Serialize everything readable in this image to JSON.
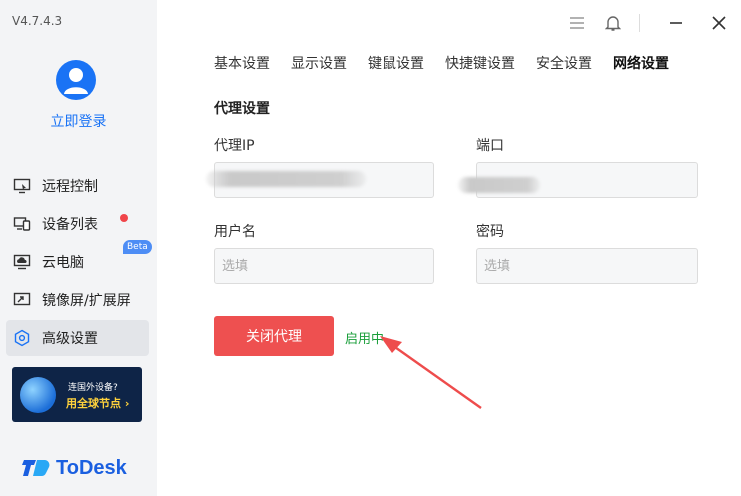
{
  "app": {
    "version": "V4.7.4.3",
    "login_label": "立即登录",
    "brand": "ToDesk",
    "accent": "#1a73f5"
  },
  "sidebar": {
    "items": [
      {
        "label": "远程控制",
        "icon": "remote-control-icon"
      },
      {
        "label": "设备列表",
        "icon": "device-list-icon",
        "notification_dot": true
      },
      {
        "label": "云电脑",
        "icon": "cloud-pc-icon",
        "badge": "Beta"
      },
      {
        "label": "镜像屏/扩展屏",
        "icon": "mirror-screen-icon"
      },
      {
        "label": "高级设置",
        "icon": "advanced-settings-icon",
        "active": true
      }
    ],
    "promo": {
      "line1": "连国外设备?",
      "line2": "用全球节点 ›"
    }
  },
  "tabs": [
    {
      "label": "基本设置"
    },
    {
      "label": "显示设置"
    },
    {
      "label": "键鼠设置"
    },
    {
      "label": "快捷键设置"
    },
    {
      "label": "安全设置"
    },
    {
      "label": "网络设置",
      "active": true
    }
  ],
  "proxy": {
    "section_title": "代理设置",
    "ip_label": "代理IP",
    "port_label": "端口",
    "username_label": "用户名",
    "username_placeholder": "选填",
    "password_label": "密码",
    "password_placeholder": "选填",
    "close_button": "关闭代理",
    "status": "启用中",
    "status_color": "#1a9e3a",
    "button_color": "#ee5050"
  }
}
